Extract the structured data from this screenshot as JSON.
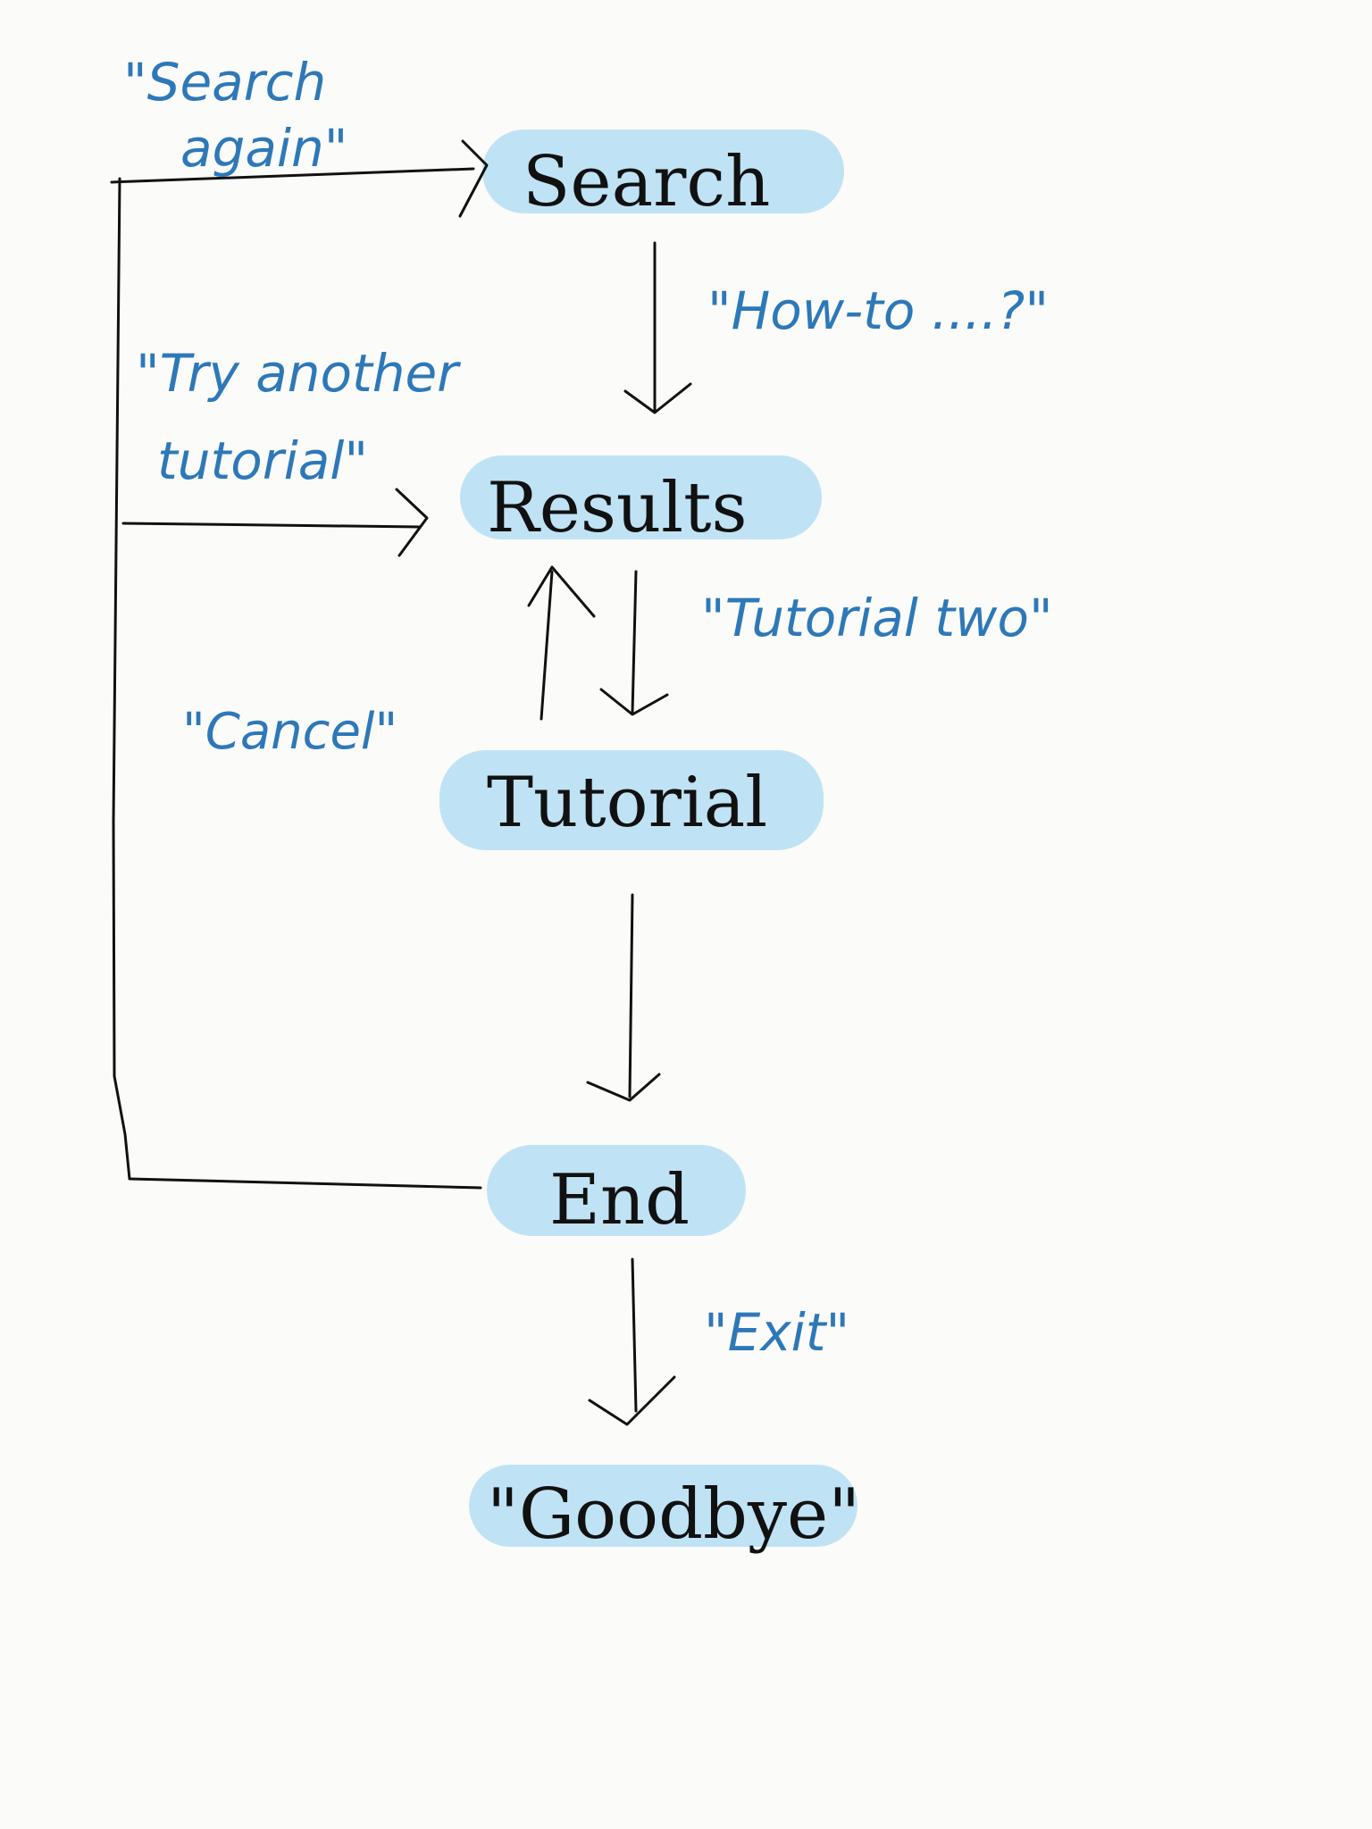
{
  "colors": {
    "node_highlight": "#bfe3f5",
    "edge_label": "#2d78b8",
    "ink": "#111111",
    "paper": "#fbfbf9"
  },
  "nodes": {
    "search": "Search",
    "results": "Results",
    "tutorial": "Tutorial",
    "end": "End",
    "goodbye": "\"Goodbye\""
  },
  "edges": {
    "search_again": {
      "line1": "\"Search",
      "line2": "again\""
    },
    "how_to": "\"How-to ....?\"",
    "try_another": {
      "line1": "\"Try another",
      "line2": "tutorial\""
    },
    "tutorial_two": "\"Tutorial two\"",
    "cancel": "\"Cancel\"",
    "exit": "\"Exit\""
  }
}
